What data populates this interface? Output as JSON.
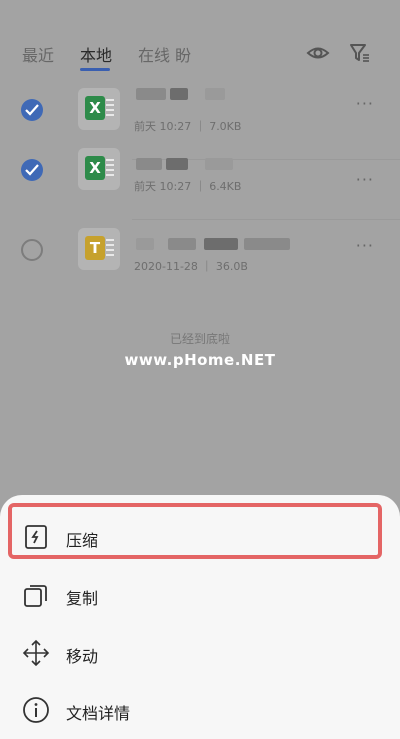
{
  "tabs": {
    "recent": "最近",
    "local": "本地",
    "online": "在线 盼"
  },
  "files": [
    {
      "checked": true,
      "type_letter": "X",
      "icon_color": "#2e8b4a",
      "meta": "前天 10:27 ｜ 7.0KB",
      "more": "···"
    },
    {
      "checked": true,
      "type_letter": "X",
      "icon_color": "#2e8b4a",
      "meta": "前天 10:27 ｜ 6.4KB",
      "more": "···"
    },
    {
      "checked": false,
      "type_letter": "T",
      "icon_color": "#c6a12d",
      "meta": "2020-11-28 ｜ 36.0B",
      "more": "···"
    }
  ],
  "end_note": "已经到底啦",
  "watermark": "www.pHome.NET",
  "menu": {
    "compress": "压缩",
    "copy": "复制",
    "move": "移动",
    "details": "文档详情"
  },
  "colors": {
    "accent": "#3f69b6",
    "highlight": "#e46565"
  }
}
